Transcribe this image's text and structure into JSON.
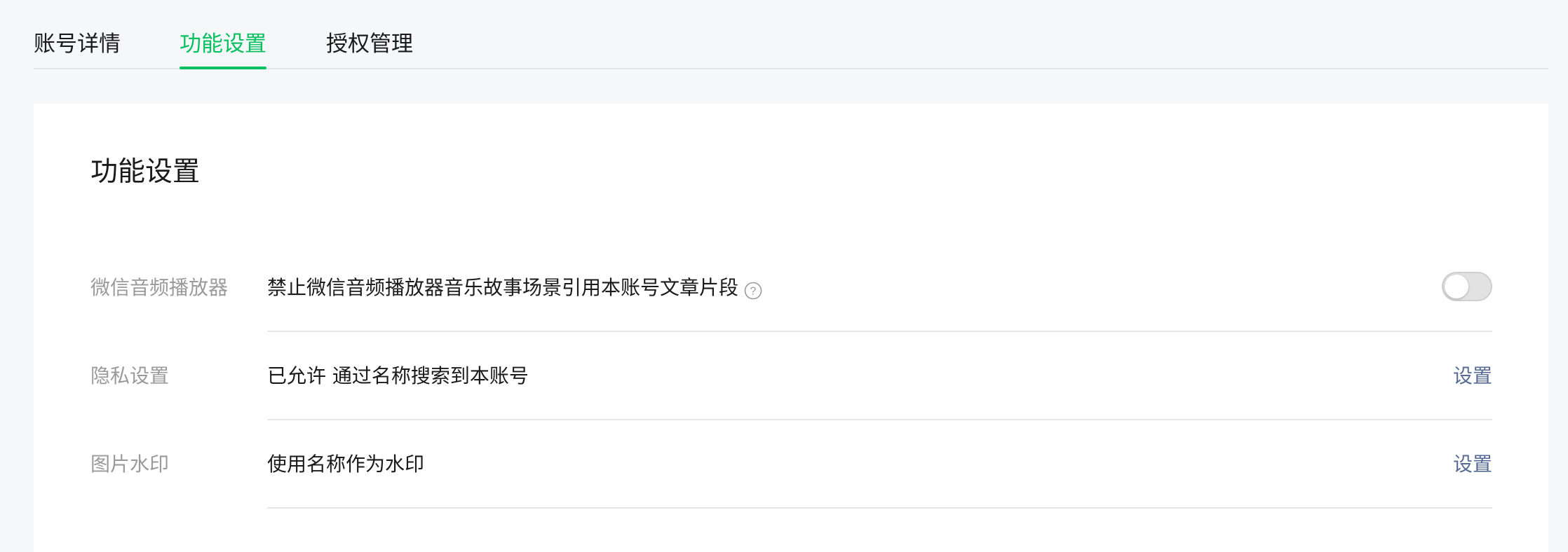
{
  "tabs": [
    {
      "label": "账号详情",
      "active": false
    },
    {
      "label": "功能设置",
      "active": true
    },
    {
      "label": "授权管理",
      "active": false
    }
  ],
  "card": {
    "title": "功能设置",
    "rows": [
      {
        "label": "微信音频播放器",
        "value": "禁止微信音频播放器音乐故事场景引用本账号文章片段",
        "help_icon": "question-circle-icon",
        "control": "toggle",
        "toggle_on": false
      },
      {
        "label": "隐私设置",
        "value": "已允许 通过名称搜索到本账号",
        "action": "设置"
      },
      {
        "label": "图片水印",
        "value": "使用名称作为水印",
        "action": "设置"
      }
    ]
  },
  "colors": {
    "accent": "#07c160",
    "link": "#576b95",
    "label": "#9a9a9a",
    "text": "#1a1a1a",
    "page_bg": "#f6f7f9"
  }
}
